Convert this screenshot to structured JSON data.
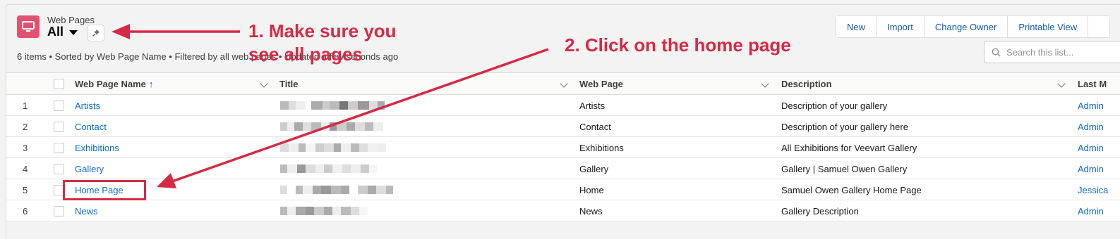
{
  "header": {
    "object_name": "Web Pages",
    "view_name": "All",
    "meta": "6 items • Sorted by Web Page Name • Filtered by all web pages • Updated a few seconds ago",
    "icon": "monitor-icon"
  },
  "toolbar": {
    "buttons": [
      "New",
      "Import",
      "Change Owner",
      "Printable View"
    ]
  },
  "search": {
    "placeholder": "Search this list..."
  },
  "table": {
    "columns": [
      "Web Page Name",
      "Title",
      "Web Page",
      "Description",
      "Last M"
    ],
    "sort_indicator": "↑",
    "rows": [
      {
        "num": "1",
        "name": "Artists",
        "web_page": "Artists",
        "description": "Description of your gallery",
        "last": "Admin"
      },
      {
        "num": "2",
        "name": "Contact",
        "web_page": "Contact",
        "description": "Description of your gallery here",
        "last": "Admin"
      },
      {
        "num": "3",
        "name": "Exhibitions",
        "web_page": "Exhibitions",
        "description": "All Exhibitions for Veevart Gallery",
        "last": "Admin"
      },
      {
        "num": "4",
        "name": "Gallery",
        "web_page": "Gallery",
        "description": "Gallery | Samuel Owen Gallery",
        "last": "Admin"
      },
      {
        "num": "5",
        "name": "Home Page",
        "web_page": "Home",
        "description": "Samuel Owen Gallery Home Page",
        "last": "Jessica"
      },
      {
        "num": "6",
        "name": "News",
        "web_page": "News",
        "description": "Gallery Description",
        "last": "Admin"
      }
    ]
  },
  "annotations": {
    "step1_line1": "1. Make sure you",
    "step1_line2": "see all pages",
    "step2": "2. Click on the home page",
    "color": "#d52a46"
  }
}
